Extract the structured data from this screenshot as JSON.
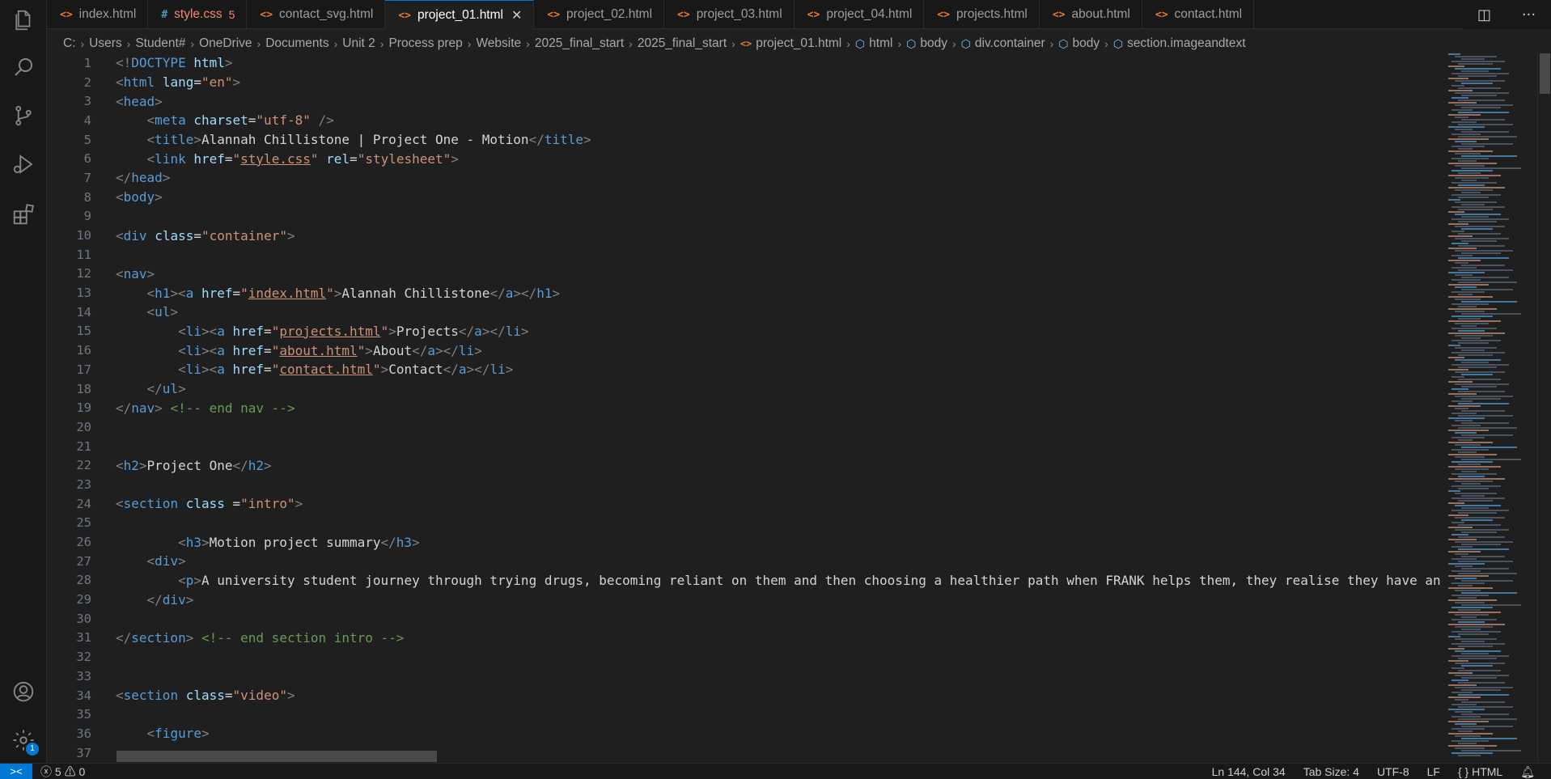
{
  "tabs": [
    {
      "name": "index.html",
      "type": "html",
      "active": false
    },
    {
      "name": "style.css",
      "type": "css",
      "active": false,
      "count": "5",
      "modified": true
    },
    {
      "name": "contact_svg.html",
      "type": "html",
      "active": false
    },
    {
      "name": "project_01.html",
      "type": "html",
      "active": true
    },
    {
      "name": "project_02.html",
      "type": "html",
      "active": false
    },
    {
      "name": "project_03.html",
      "type": "html",
      "active": false
    },
    {
      "name": "project_04.html",
      "type": "html",
      "active": false
    },
    {
      "name": "projects.html",
      "type": "html",
      "active": false
    },
    {
      "name": "about.html",
      "type": "html",
      "active": false
    },
    {
      "name": "contact.html",
      "type": "html",
      "active": false
    }
  ],
  "breadcrumb": [
    {
      "label": "C:",
      "icon": ""
    },
    {
      "label": "Users",
      "icon": ""
    },
    {
      "label": "Student#",
      "icon": ""
    },
    {
      "label": "OneDrive",
      "icon": ""
    },
    {
      "label": "Documents",
      "icon": ""
    },
    {
      "label": "Unit 2",
      "icon": ""
    },
    {
      "label": "Process prep",
      "icon": ""
    },
    {
      "label": "Website",
      "icon": ""
    },
    {
      "label": "2025_final_start",
      "icon": ""
    },
    {
      "label": "2025_final_start",
      "icon": ""
    },
    {
      "label": "project_01.html",
      "icon": "html"
    },
    {
      "label": "html",
      "icon": "cube"
    },
    {
      "label": "body",
      "icon": "cube"
    },
    {
      "label": "div.container",
      "icon": "cube"
    },
    {
      "label": "body",
      "icon": "cube"
    },
    {
      "label": "section.imageandtext",
      "icon": "cube"
    }
  ],
  "code_lines": [
    [
      [
        "p",
        "<!"
      ],
      [
        "t",
        "DOCTYPE"
      ],
      [
        "x",
        " "
      ],
      [
        "a",
        "html"
      ],
      [
        "p",
        ">"
      ]
    ],
    [
      [
        "p",
        "<"
      ],
      [
        "t",
        "html"
      ],
      [
        "x",
        " "
      ],
      [
        "a",
        "lang"
      ],
      [
        "x",
        "="
      ],
      [
        "s",
        "\"en\""
      ],
      [
        "p",
        ">"
      ]
    ],
    [
      [
        "p",
        "<"
      ],
      [
        "t",
        "head"
      ],
      [
        "p",
        ">"
      ]
    ],
    [
      [
        "x",
        "    "
      ],
      [
        "p",
        "<"
      ],
      [
        "t",
        "meta"
      ],
      [
        "x",
        " "
      ],
      [
        "a",
        "charset"
      ],
      [
        "x",
        "="
      ],
      [
        "s",
        "\"utf-8\""
      ],
      [
        "x",
        " "
      ],
      [
        "p",
        "/>"
      ]
    ],
    [
      [
        "x",
        "    "
      ],
      [
        "p",
        "<"
      ],
      [
        "t",
        "title"
      ],
      [
        "p",
        ">"
      ],
      [
        "x",
        "Alannah Chillistone | Project One - Motion"
      ],
      [
        "p",
        "</"
      ],
      [
        "t",
        "title"
      ],
      [
        "p",
        ">"
      ]
    ],
    [
      [
        "x",
        "    "
      ],
      [
        "p",
        "<"
      ],
      [
        "t",
        "link"
      ],
      [
        "x",
        " "
      ],
      [
        "a",
        "href"
      ],
      [
        "x",
        "="
      ],
      [
        "s",
        "\""
      ],
      [
        "l",
        "style.css"
      ],
      [
        "s",
        "\""
      ],
      [
        "x",
        " "
      ],
      [
        "a",
        "rel"
      ],
      [
        "x",
        "="
      ],
      [
        "s",
        "\"stylesheet\""
      ],
      [
        "p",
        ">"
      ]
    ],
    [
      [
        "p",
        "</"
      ],
      [
        "t",
        "head"
      ],
      [
        "p",
        ">"
      ]
    ],
    [
      [
        "p",
        "<"
      ],
      [
        "t",
        "body"
      ],
      [
        "p",
        ">"
      ]
    ],
    [],
    [
      [
        "p",
        "<"
      ],
      [
        "t",
        "div"
      ],
      [
        "x",
        " "
      ],
      [
        "a",
        "class"
      ],
      [
        "x",
        "="
      ],
      [
        "s",
        "\"container\""
      ],
      [
        "p",
        ">"
      ]
    ],
    [],
    [
      [
        "p",
        "<"
      ],
      [
        "t",
        "nav"
      ],
      [
        "p",
        ">"
      ]
    ],
    [
      [
        "x",
        "    "
      ],
      [
        "p",
        "<"
      ],
      [
        "t",
        "h1"
      ],
      [
        "p",
        "><"
      ],
      [
        "t",
        "a"
      ],
      [
        "x",
        " "
      ],
      [
        "a",
        "href"
      ],
      [
        "x",
        "="
      ],
      [
        "s",
        "\""
      ],
      [
        "l",
        "index.html"
      ],
      [
        "s",
        "\""
      ],
      [
        "p",
        ">"
      ],
      [
        "x",
        "Alannah Chillistone"
      ],
      [
        "p",
        "</"
      ],
      [
        "t",
        "a"
      ],
      [
        "p",
        "></"
      ],
      [
        "t",
        "h1"
      ],
      [
        "p",
        ">"
      ]
    ],
    [
      [
        "x",
        "    "
      ],
      [
        "p",
        "<"
      ],
      [
        "t",
        "ul"
      ],
      [
        "p",
        ">"
      ]
    ],
    [
      [
        "x",
        "        "
      ],
      [
        "p",
        "<"
      ],
      [
        "t",
        "li"
      ],
      [
        "p",
        "><"
      ],
      [
        "t",
        "a"
      ],
      [
        "x",
        " "
      ],
      [
        "a",
        "href"
      ],
      [
        "x",
        "="
      ],
      [
        "s",
        "\""
      ],
      [
        "l",
        "projects.html"
      ],
      [
        "s",
        "\""
      ],
      [
        "p",
        ">"
      ],
      [
        "x",
        "Projects"
      ],
      [
        "p",
        "</"
      ],
      [
        "t",
        "a"
      ],
      [
        "p",
        "></"
      ],
      [
        "t",
        "li"
      ],
      [
        "p",
        ">"
      ]
    ],
    [
      [
        "x",
        "        "
      ],
      [
        "p",
        "<"
      ],
      [
        "t",
        "li"
      ],
      [
        "p",
        "><"
      ],
      [
        "t",
        "a"
      ],
      [
        "x",
        " "
      ],
      [
        "a",
        "href"
      ],
      [
        "x",
        "="
      ],
      [
        "s",
        "\""
      ],
      [
        "l",
        "about.html"
      ],
      [
        "s",
        "\""
      ],
      [
        "p",
        ">"
      ],
      [
        "x",
        "About"
      ],
      [
        "p",
        "</"
      ],
      [
        "t",
        "a"
      ],
      [
        "p",
        "></"
      ],
      [
        "t",
        "li"
      ],
      [
        "p",
        ">"
      ]
    ],
    [
      [
        "x",
        "        "
      ],
      [
        "p",
        "<"
      ],
      [
        "t",
        "li"
      ],
      [
        "p",
        "><"
      ],
      [
        "t",
        "a"
      ],
      [
        "x",
        " "
      ],
      [
        "a",
        "href"
      ],
      [
        "x",
        "="
      ],
      [
        "s",
        "\""
      ],
      [
        "l",
        "contact.html"
      ],
      [
        "s",
        "\""
      ],
      [
        "p",
        ">"
      ],
      [
        "x",
        "Contact"
      ],
      [
        "p",
        "</"
      ],
      [
        "t",
        "a"
      ],
      [
        "p",
        "></"
      ],
      [
        "t",
        "li"
      ],
      [
        "p",
        ">"
      ]
    ],
    [
      [
        "x",
        "    "
      ],
      [
        "p",
        "</"
      ],
      [
        "t",
        "ul"
      ],
      [
        "p",
        ">"
      ]
    ],
    [
      [
        "p",
        "</"
      ],
      [
        "t",
        "nav"
      ],
      [
        "p",
        ">"
      ],
      [
        "x",
        " "
      ],
      [
        "c",
        "<!-- end nav -->"
      ]
    ],
    [],
    [],
    [
      [
        "p",
        "<"
      ],
      [
        "t",
        "h2"
      ],
      [
        "p",
        ">"
      ],
      [
        "x",
        "Project One"
      ],
      [
        "p",
        "</"
      ],
      [
        "t",
        "h2"
      ],
      [
        "p",
        ">"
      ]
    ],
    [],
    [
      [
        "p",
        "<"
      ],
      [
        "t",
        "section"
      ],
      [
        "x",
        " "
      ],
      [
        "a",
        "class"
      ],
      [
        "x",
        " ="
      ],
      [
        "s",
        "\"intro\""
      ],
      [
        "p",
        ">"
      ]
    ],
    [],
    [
      [
        "x",
        "        "
      ],
      [
        "p",
        "<"
      ],
      [
        "t",
        "h3"
      ],
      [
        "p",
        ">"
      ],
      [
        "x",
        "Motion project summary"
      ],
      [
        "p",
        "</"
      ],
      [
        "t",
        "h3"
      ],
      [
        "p",
        ">"
      ]
    ],
    [
      [
        "x",
        "    "
      ],
      [
        "p",
        "<"
      ],
      [
        "t",
        "div"
      ],
      [
        "p",
        ">"
      ]
    ],
    [
      [
        "x",
        "        "
      ],
      [
        "p",
        "<"
      ],
      [
        "t",
        "p"
      ],
      [
        "p",
        ">"
      ],
      [
        "x",
        "A university student journey through trying drugs, becoming reliant on them and then choosing a healthier path when FRANK helps them, they realise they have an"
      ]
    ],
    [
      [
        "x",
        "    "
      ],
      [
        "p",
        "</"
      ],
      [
        "t",
        "div"
      ],
      [
        "p",
        ">"
      ]
    ],
    [],
    [
      [
        "p",
        "</"
      ],
      [
        "t",
        "section"
      ],
      [
        "p",
        ">"
      ],
      [
        "x",
        " "
      ],
      [
        "c",
        "<!-- end section intro -->"
      ]
    ],
    [],
    [],
    [
      [
        "p",
        "<"
      ],
      [
        "t",
        "section"
      ],
      [
        "x",
        " "
      ],
      [
        "a",
        "class"
      ],
      [
        "x",
        "="
      ],
      [
        "s",
        "\"video\""
      ],
      [
        "p",
        ">"
      ]
    ],
    [],
    [
      [
        "x",
        "    "
      ],
      [
        "p",
        "<"
      ],
      [
        "t",
        "figure"
      ],
      [
        "p",
        ">"
      ]
    ],
    []
  ],
  "status": {
    "remote_icon": "><",
    "errors": "5",
    "warnings": "0",
    "position": "Ln 144, Col 34",
    "tab_size": "Tab Size: 4",
    "encoding": "UTF-8",
    "eol": "LF",
    "language": "{ } HTML"
  },
  "activity": {
    "settings_badge": "1"
  }
}
